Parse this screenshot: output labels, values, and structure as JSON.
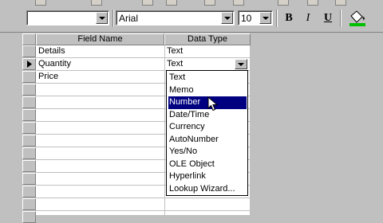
{
  "toolbar": {
    "font_name": "Arial",
    "font_size": "10",
    "bold": "B",
    "italic": "I",
    "underline": "U"
  },
  "table": {
    "headers": [
      "Field Name",
      "Data Type"
    ],
    "rows": [
      {
        "field": "Details",
        "type": "Text"
      },
      {
        "field": "Quantity",
        "type": "Text"
      },
      {
        "field": "Price",
        "type": ""
      }
    ]
  },
  "dropdown": {
    "selected_index": 2,
    "items": [
      "Text",
      "Memo",
      "Number",
      "Date/Time",
      "Currency",
      "AutoNumber",
      "Yes/No",
      "OLE Object",
      "Hyperlink",
      "Lookup Wizard..."
    ]
  }
}
